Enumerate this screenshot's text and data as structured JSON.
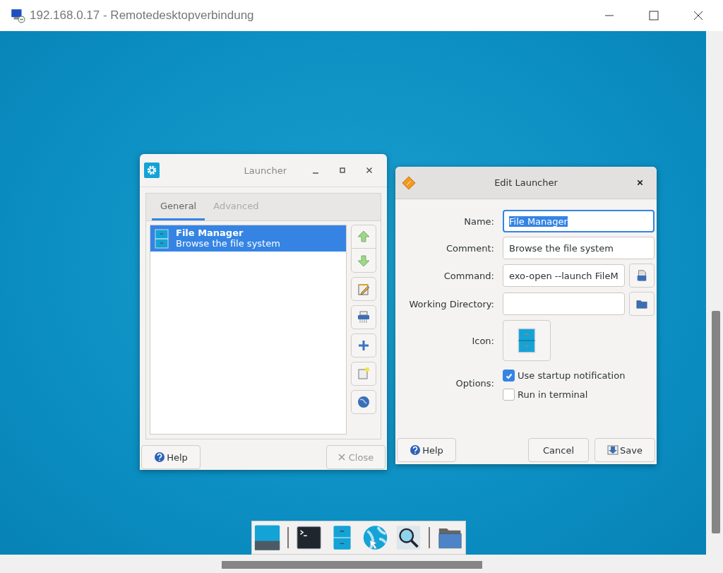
{
  "window": {
    "title": "192.168.0.17 - Remotedesktopverbindung"
  },
  "launcher": {
    "title": "Launcher",
    "tabs": [
      {
        "label": "General",
        "selected": true
      },
      {
        "label": "Advanced",
        "selected": false
      }
    ],
    "items": [
      {
        "name": "File Manager",
        "comment": "Browse the file system",
        "selected": true
      }
    ],
    "buttons": [
      {
        "label": "Help",
        "kind": "help",
        "disabled": false
      },
      {
        "label": "Close",
        "kind": "close",
        "disabled": true
      }
    ]
  },
  "editor": {
    "title": "Edit Launcher",
    "fields": [
      {
        "label": "Name:",
        "value": "File Manager",
        "kind": "text",
        "focused": true
      },
      {
        "label": "Comment:",
        "value": "Browse the file system",
        "kind": "text",
        "focused": false
      },
      {
        "label": "Command:",
        "value": "exo-open --launch FileM",
        "kind": "file",
        "focused": false
      },
      {
        "label": "Working Directory:",
        "kind": "folder",
        "focused": false
      },
      {
        "label": "Icon:",
        "kind": "icon"
      }
    ],
    "options_label": "Options:",
    "options": [
      {
        "label": "Use startup notification",
        "checked": true
      },
      {
        "label": "Run in terminal",
        "checked": false
      }
    ],
    "buttons": [
      {
        "label": "Help",
        "kind": "help"
      },
      {
        "label": "Cancel",
        "kind": "cancel"
      },
      {
        "label": "Save",
        "kind": "save"
      }
    ]
  }
}
